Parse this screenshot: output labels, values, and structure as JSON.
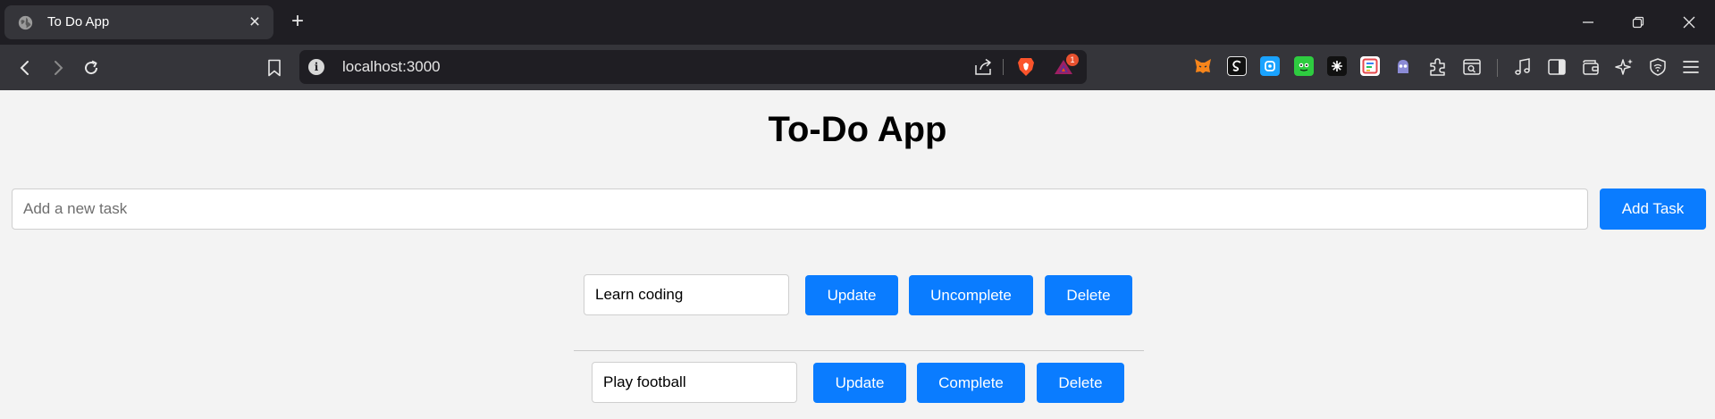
{
  "browser": {
    "tab": {
      "title": "To Do App"
    },
    "address_bar": {
      "url": "localhost:3000",
      "rewards_badge": "1"
    },
    "extensions": [
      {
        "name": "metamask-extension-icon",
        "color": "#f6851b"
      },
      {
        "name": "extension-2-icon",
        "color": "#111111"
      },
      {
        "name": "extension-3-icon",
        "color": "#1aa3ff"
      },
      {
        "name": "extension-4-icon",
        "color": "#2ecc40"
      },
      {
        "name": "extension-5-icon",
        "color": "#111111"
      },
      {
        "name": "extension-6-icon",
        "color": "#e5484d"
      },
      {
        "name": "extension-7-icon",
        "color": "#8b8bd6"
      }
    ]
  },
  "app": {
    "title": "To-Do App",
    "new_task": {
      "placeholder": "Add a new task",
      "value": ""
    },
    "add_button_label": "Add Task",
    "tasks": [
      {
        "text": "Learn coding",
        "update_label": "Update",
        "toggle_label": "Uncomplete",
        "delete_label": "Delete",
        "completed": true
      },
      {
        "text": "Play football",
        "update_label": "Update",
        "toggle_label": "Complete",
        "delete_label": "Delete",
        "completed": false
      }
    ]
  },
  "colors": {
    "primary_button": "#0a7cff",
    "page_background": "#f3f3f3"
  }
}
